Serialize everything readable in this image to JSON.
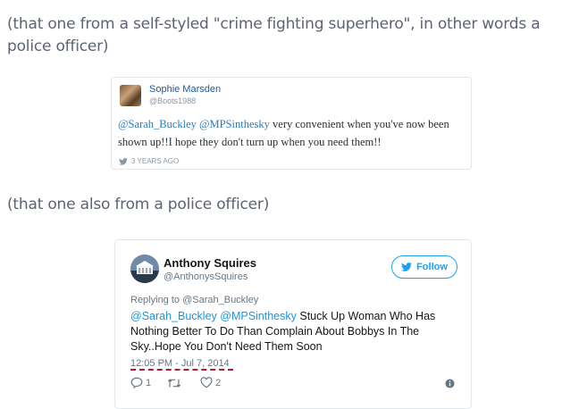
{
  "captions": {
    "first": "(that one from a self-styled \"crime fighting superhero\", in other words a police officer)",
    "second": "(that one also from a police officer)"
  },
  "tweet1": {
    "name": "Sophie Marsden",
    "handle": "@Boots1988",
    "mention1": "@Sarah_Buckley",
    "mention2": "@MPSinthesky",
    "text": " very convenient when you've now been shown up!!I hope they don't turn up when you need them!!",
    "timestamp": "3 YEARS AGO"
  },
  "tweet2": {
    "name": "Anthony Squires",
    "handle": "@AnthonysSquires",
    "follow_label": "Follow",
    "replying_to": "Replying to @Sarah_Buckley",
    "mention1": "@Sarah_Buckley",
    "mention2": "@MPSinthesky",
    "text": " Stuck Up Woman Who Has Nothing Better To Do Than Complain About Bobbys In The Sky..Hope You Don't Need Them Soon",
    "time": "12:05 PM - Jul 7, 2014",
    "replies": "1",
    "retweets": "",
    "likes": "2",
    "accent_color": "#1da1f2"
  }
}
